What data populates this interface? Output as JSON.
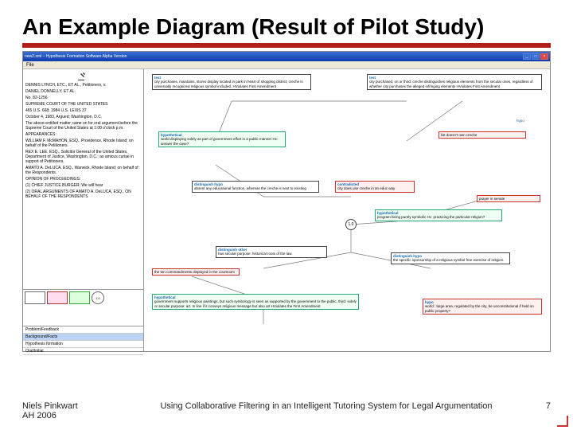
{
  "slide": {
    "title": "An Example Diagram (Result of Pilot Study)",
    "footer_author": "Niels Pinkwart",
    "footer_venue": "AH 2006",
    "footer_title": "Using Collaborative Filtering in an Intelligent Tutoring System for Legal Argumentation",
    "page": "7"
  },
  "app": {
    "window_title": "new2.xml – Hypothesis Formation Software Alpha Version",
    "menu": {
      "file": "File"
    },
    "case_text": [
      "DENNIS LYNCH, ETC., ET AL., Petitioners, v.",
      "DANIEL DONNELLY, ET AL.",
      "No. 82-1256",
      "SUPREME COURT OF THE UNITED STATES",
      "465 U.S. 668; 1984 U.S. LEXIS 37",
      "October 4, 1983, Argued; Washington, D.C.",
      "The above-entitled matter came on for oral argument before the Supreme Court of the United States at 1:00 o'clock p.m.",
      "APPEARANCES:",
      "WILLIAM F. McMAHON, ESQ., Providence, Rhode Island; on behalf of the Petitioners.",
      "REX E. LEE, ESQ., Solicitor General of the United States, Department of Justice, Washington, D.C.; as amicus curiae in support of Petitioners.",
      "AMATO A. DeLUCA, ESQ., Warwick, Rhode Island; on behalf of the Respondents.",
      "OPINION OF PROCEEDINGS:",
      "(1) CHIEF JUSTICE BURGER: We will hear",
      "(2) ORAL ARGUMENTS OF AMATO A. DeLUCA, ESQ., ON BEHALF OF THE RESPONDENTS"
    ],
    "modes": {
      "m1": "Problem/Feedback",
      "m2": "Background/Facts",
      "m3": "Hypothesis formation",
      "m4": "Oral/Initial"
    },
    "nodes": {
      "n1": {
        "head": "test",
        "body": "city purchases, maintains, stores display located in park in heart of shopping district; creche is universally recognized religious symbol included.\nHViolates First Amendment"
      },
      "n2": {
        "head": "test",
        "body": "city purchased, on or\nthird: creche distinguishes religious elements from the secular ones, regardless of whether city purchases the alleged infringing elements\nHViolates First Amendment"
      },
      "n3": {
        "head": "hypothetical",
        "body": "world displaying solely as part of government effort in a public manner\nHc: answer the case?"
      },
      "n4": {
        "body": "list doesn't own creche"
      },
      "n5": {
        "head": "distinguish hypo",
        "body": "absent any educational function, whereas the creche is next to existing"
      },
      "n6": {
        "head": "contradicted",
        "body": "city does use creche in an educ way"
      },
      "n7": {
        "head": "hypothetical",
        "body": "program being purely symbolic\nHc: practicing the particular religion?"
      },
      "n8": {
        "body": "prayer in senate"
      },
      "n9": {
        "head": "distinguish other",
        "body": "has secular purpose: historical roots of the law."
      },
      "n10": {
        "head": "distinguish hypo",
        "body": "the specific sponsorship of a religious symbol free exercise of religion."
      },
      "n11": {
        "head": "",
        "body": "the ten commandments displayed in the courtroom"
      },
      "n12": {
        "head": "hypothetical",
        "body": "government supports religious paintings, but such symbology is seen as supported by the government to the public.\nthird: solely or secular purpose: art. In line if it conveys religious message but also art\nHViolates the First Amendment"
      },
      "n13": {
        "head": "hypo",
        "body": "world : large area, regulated by the city, be unconstitutional if held on public property?"
      }
    },
    "tags": {
      "t1": "hypo",
      "t2": "1.0"
    }
  }
}
